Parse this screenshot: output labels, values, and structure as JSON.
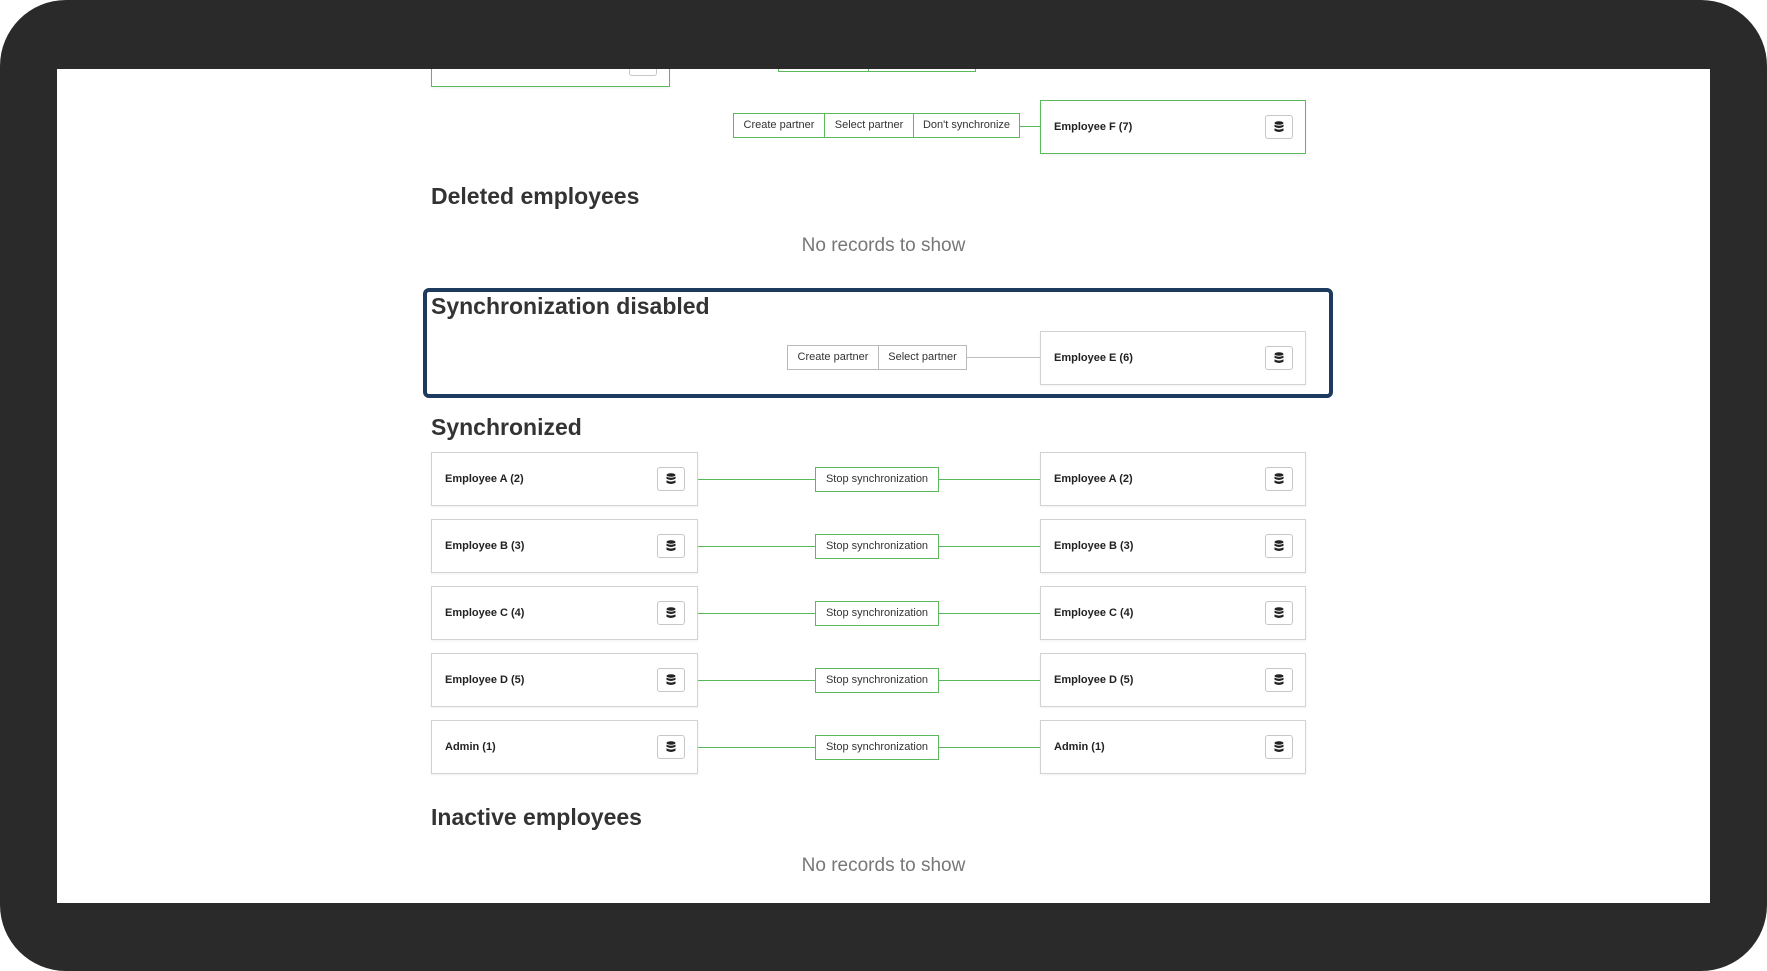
{
  "top_partial": {
    "actions": [
      "Create partner",
      "Select partner",
      "Don't synchronize"
    ],
    "employee": "Employee F (7)"
  },
  "deleted": {
    "title": "Deleted employees",
    "empty_text": "No records to show"
  },
  "sync_disabled": {
    "title": "Synchronization disabled",
    "actions": [
      "Create partner",
      "Select partner"
    ],
    "employee": "Employee E (6)"
  },
  "synchronized": {
    "title": "Synchronized",
    "stop_label": "Stop synchronization",
    "rows": [
      {
        "left": "Employee A (2)",
        "right": "Employee A (2)"
      },
      {
        "left": "Employee B (3)",
        "right": "Employee B (3)"
      },
      {
        "left": "Employee C (4)",
        "right": "Employee C (4)"
      },
      {
        "left": "Employee D (5)",
        "right": "Employee D (5)"
      },
      {
        "left": "Admin (1)",
        "right": "Admin (1)"
      }
    ]
  },
  "inactive": {
    "title": "Inactive employees",
    "empty_text": "No records to show"
  },
  "colors": {
    "accent_green": "#5cb85c",
    "focus_border": "#1f3a5f",
    "bezel": "#2a2a2a"
  },
  "icons": {
    "record_button": "database-icon"
  }
}
